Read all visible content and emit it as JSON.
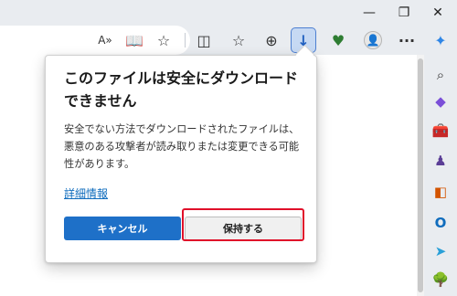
{
  "window_controls": {
    "minimize": "—",
    "restore": "❐",
    "close": "✕"
  },
  "toolbar": {
    "read_aloud": "A»",
    "immersive_reader": "📖",
    "favorite": "☆",
    "split_screen": "◫",
    "favorites": "☆",
    "collections": "⊕",
    "download": "↓",
    "extensions": "♥",
    "profile": "👤",
    "more": "···",
    "copilot": "✦"
  },
  "sidebar": {
    "search": "⌕",
    "shopping": "◆",
    "tools": "🧰",
    "games": "♟",
    "office": "◧",
    "outlook": "O",
    "drop": "➤",
    "tree": "🌳"
  },
  "dialog": {
    "title": "このファイルは安全にダウンロードできません",
    "body": "安全でない方法でダウンロードされたファイルは、悪意のある攻撃者が読み取りまたは変更できる可能性があります。",
    "link": "詳細情報",
    "cancel_label": "キャンセル",
    "keep_label": "保持する"
  }
}
